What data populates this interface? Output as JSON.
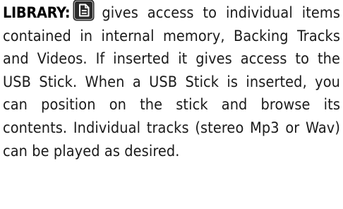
{
  "paragraph": {
    "heading": "LIBRARY:",
    "icon": "document-icon",
    "body": "gives access to individual items contained in internal memory, Backing Tracks and Videos. If inserted it gives access to the USB Stick. When a USB Stick is inserted, you can position on the stick and browse its contents. Individual tracks (stereo Mp3 or Wav) can be played as desired."
  },
  "colors": {
    "icon_fill": "#2b2b2b",
    "text": "#1a1a1a"
  }
}
